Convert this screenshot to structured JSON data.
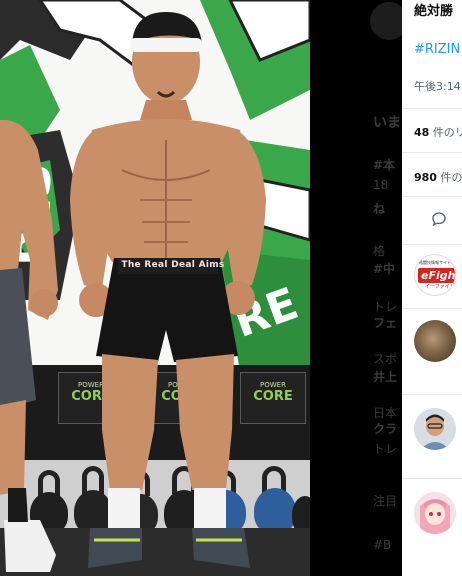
{
  "photo": {
    "waistband_text": "The Real Deal Aims",
    "sign_text": "POWER CORE"
  },
  "tweet": {
    "title": "絶対勝",
    "hashtag": "#RIZIN",
    "time": "午後3:14",
    "retweets_count": "48",
    "retweets_label": "件のリ",
    "likes_count": "980",
    "likes_label": "件の"
  },
  "background_text": {
    "line1": "いま",
    "line2": "#本",
    "line3": "18",
    "line4": "ね",
    "line5": "格",
    "line6": "#中",
    "line7": "トレ",
    "line8": "フェ",
    "line9": "スポ",
    "line10": "井上",
    "line11": "日本",
    "line12": "クラ",
    "line13": "トレ",
    "line14": "注目",
    "line15": "#B"
  },
  "sidebar_avatars": [
    {
      "name": "efight-avatar",
      "top_text": "格闘技情報サイト",
      "brand": "eFight",
      "sub": "イーファイト"
    },
    {
      "name": "cat-avatar"
    },
    {
      "name": "man-avatar"
    },
    {
      "name": "anime-avatar"
    }
  ],
  "colors": {
    "banner_green": "#3aa84a",
    "accent_blue": "#1d9bf0",
    "muted_gray": "#536471"
  }
}
